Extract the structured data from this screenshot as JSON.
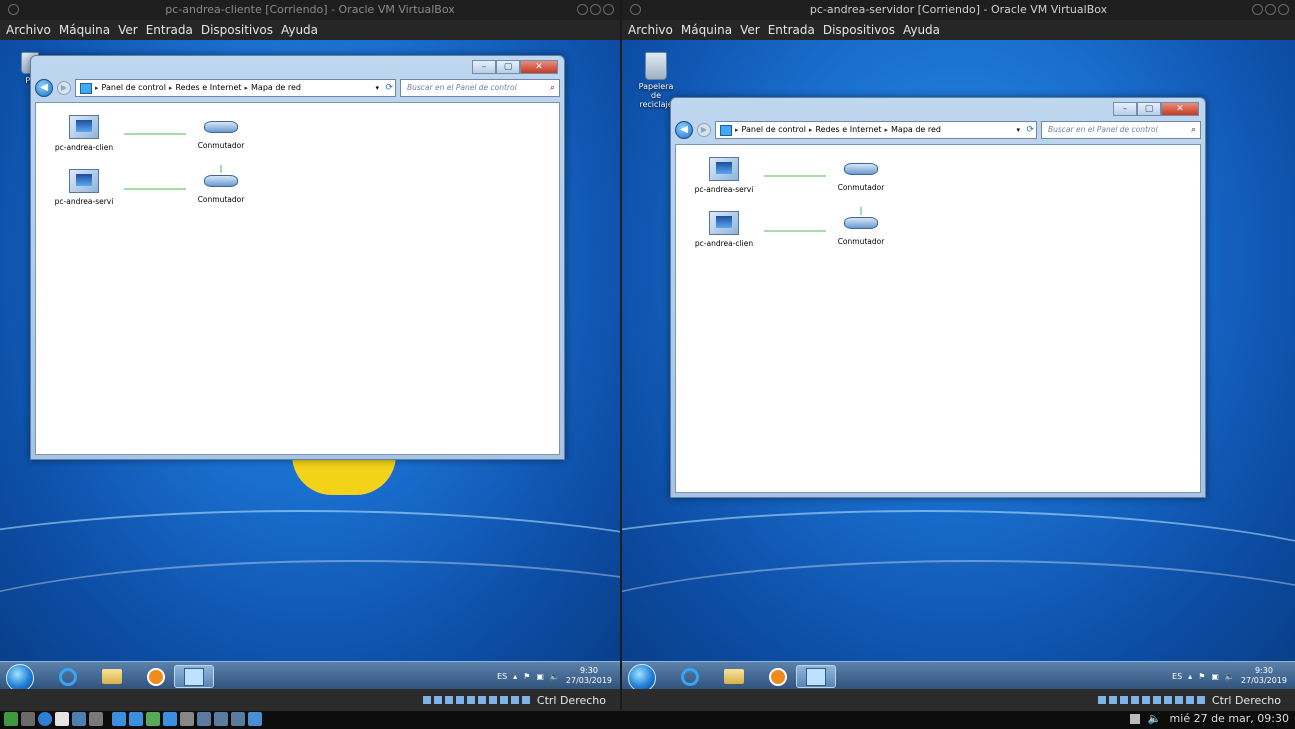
{
  "vms": [
    {
      "title": "pc-andrea-cliente [Corriendo] - Oracle VM VirtualBox",
      "menu": [
        "Archivo",
        "Máquina",
        "Ver",
        "Entrada",
        "Dispositivos",
        "Ayuda"
      ],
      "desktop_icon_label": "Pa",
      "window": {
        "breadcrumb": [
          "Panel de control",
          "Redes e Internet",
          "Mapa de red"
        ],
        "search_placeholder": "Buscar en el Panel de control",
        "map": {
          "row1_pc": "pc-andrea-clien",
          "row1_switch": "Conmutador",
          "row2_pc": "pc-andrea-servi",
          "row2_switch": "Conmutador"
        }
      },
      "tray": {
        "lang": "ES",
        "time": "9:30",
        "date": "27/03/2019"
      },
      "host_key": "Ctrl Derecho"
    },
    {
      "title": "pc-andrea-servidor [Corriendo] - Oracle VM VirtualBox",
      "menu": [
        "Archivo",
        "Máquina",
        "Ver",
        "Entrada",
        "Dispositivos",
        "Ayuda"
      ],
      "desktop_icon_label": "Papelera de reciclaje",
      "window": {
        "breadcrumb": [
          "Panel de control",
          "Redes e Internet",
          "Mapa de red"
        ],
        "search_placeholder": "Buscar en el Panel de control",
        "map": {
          "row1_pc": "pc-andrea-servi",
          "row1_switch": "Conmutador",
          "row2_pc": "pc-andrea-clien",
          "row2_switch": "Conmutador"
        }
      },
      "tray": {
        "lang": "ES",
        "time": "9:30",
        "date": "27/03/2019"
      },
      "host_key": "Ctrl Derecho"
    }
  ],
  "host": {
    "clock": "mié 27 de mar, 09:30"
  },
  "colors": {
    "win7_blue": "#1a6fcf",
    "aero_frame": "#bed6ee",
    "vbox_bg": "#2b2b2b"
  }
}
